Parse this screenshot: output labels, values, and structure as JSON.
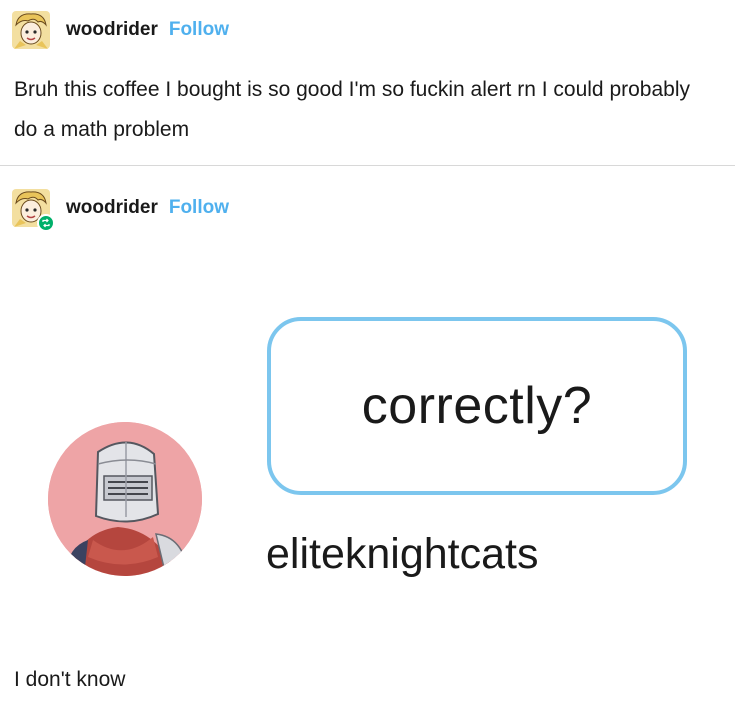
{
  "post": {
    "username": "woodrider",
    "follow_label": "Follow",
    "body": "Bruh this coffee I bought is so good I'm so fuckin alert rn I could probably do a math problem"
  },
  "reblog": {
    "username": "woodrider",
    "follow_label": "Follow",
    "image": {
      "bubble_text": "correctly?",
      "handle": "eliteknightcats"
    },
    "reply_text": "I don't know"
  },
  "colors": {
    "follow": "#4fb0ee",
    "bubble_border": "#7cc6ee",
    "knight_avatar_bg": "#eea4a6",
    "reblog_badge": "#00b06a",
    "divider": "#d8d8d8"
  },
  "icons": {
    "user_avatar": "cartoon-blonde-character-avatar-icon",
    "reblog_badge": "reblog-arrows-icon",
    "knight_avatar": "armored-knight-avatar-icon"
  }
}
